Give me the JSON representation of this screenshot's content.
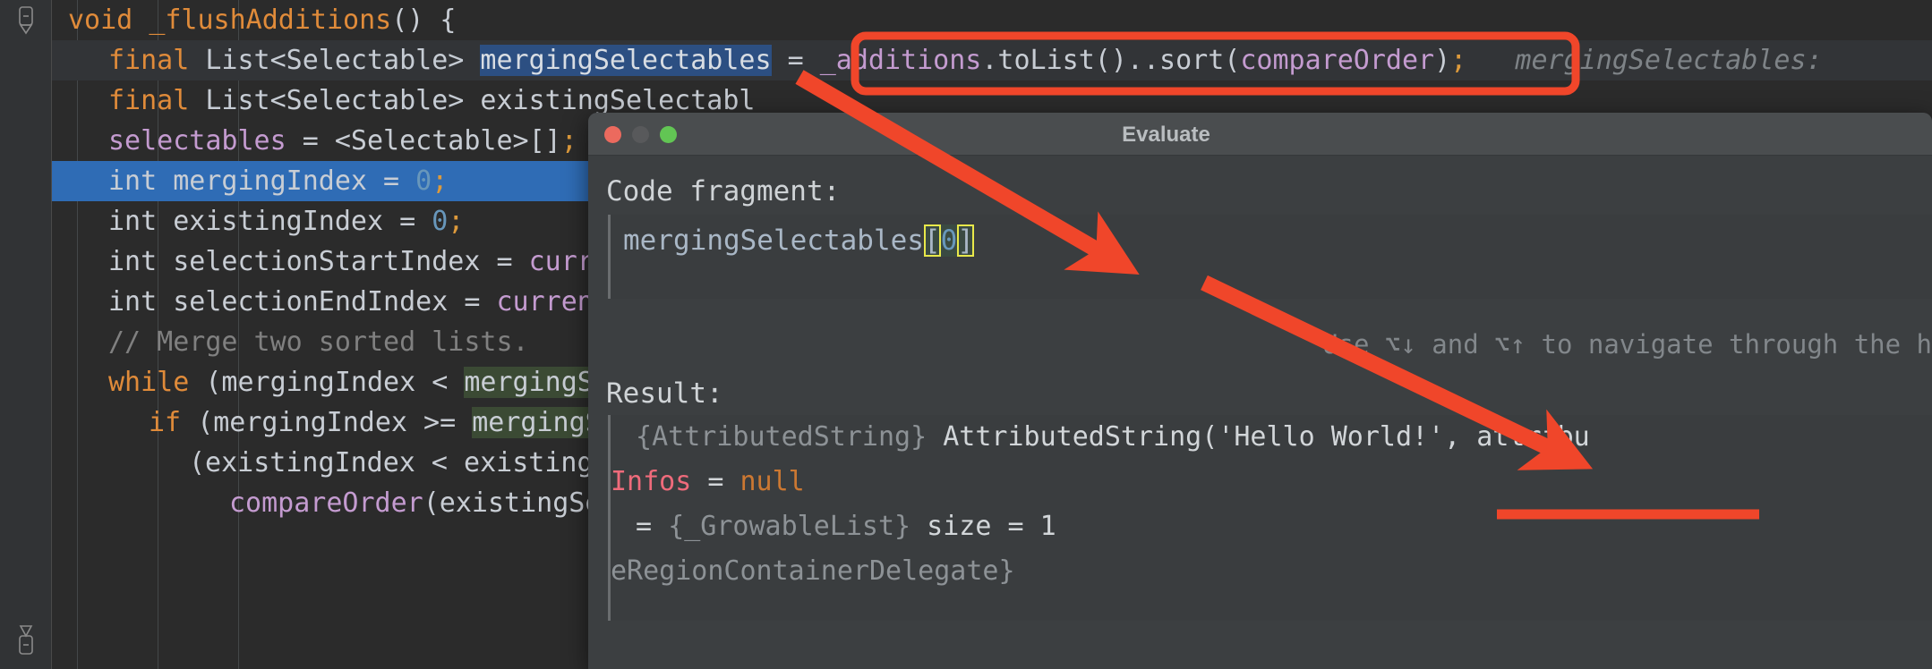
{
  "editor": {
    "lines": [
      {
        "indent": 0,
        "tokens": [
          {
            "t": "void ",
            "c": "kw-void"
          },
          {
            "t": "_flushAdditions",
            "c": "fn"
          },
          {
            "t": "() {",
            "c": "plain"
          }
        ],
        "state": "normal"
      },
      {
        "indent": 1,
        "tokens": [
          {
            "t": "final ",
            "c": "kw"
          },
          {
            "t": "List<Selectable> ",
            "c": "type"
          },
          {
            "t": "mergingSelectables",
            "c": "sel-blue"
          },
          {
            "t": " = ",
            "c": "plain"
          },
          {
            "t": "_additions",
            "c": "field"
          },
          {
            "t": ".toList()..",
            "c": "plain"
          },
          {
            "t": "sort",
            "c": "plain"
          },
          {
            "t": "(",
            "c": "plain"
          },
          {
            "t": "compareOrder",
            "c": "field"
          },
          {
            "t": ")",
            "c": "plain"
          },
          {
            "t": ";",
            "c": "punc"
          }
        ],
        "hint": "   mergingSelectables:",
        "state": "soft-hl"
      },
      {
        "indent": 1,
        "tokens": [
          {
            "t": "final ",
            "c": "kw"
          },
          {
            "t": "List<Selectable> ",
            "c": "type"
          },
          {
            "t": "existingSelectabl",
            "c": "plain"
          }
        ],
        "state": "normal"
      },
      {
        "indent": 1,
        "tokens": [
          {
            "t": "selectables",
            "c": "field"
          },
          {
            "t": " = <Selectable>[]",
            "c": "plain"
          },
          {
            "t": ";",
            "c": "punc"
          }
        ],
        "state": "normal"
      },
      {
        "indent": 1,
        "tokens": [
          {
            "t": "int mergingIndex = ",
            "c": "plain"
          },
          {
            "t": "0",
            "c": "num"
          },
          {
            "t": ";",
            "c": "punc"
          }
        ],
        "state": "caret-line"
      },
      {
        "indent": 1,
        "tokens": [
          {
            "t": "int existingIndex = ",
            "c": "plain"
          },
          {
            "t": "0",
            "c": "num"
          },
          {
            "t": ";",
            "c": "punc"
          }
        ],
        "state": "normal"
      },
      {
        "indent": 1,
        "tokens": [
          {
            "t": "int selectionStartIndex = ",
            "c": "plain"
          },
          {
            "t": "currentSelecti",
            "c": "field"
          }
        ],
        "state": "normal"
      },
      {
        "indent": 1,
        "tokens": [
          {
            "t": "int selectionEndIndex = ",
            "c": "plain"
          },
          {
            "t": "currentSelection",
            "c": "field"
          }
        ],
        "state": "normal"
      },
      {
        "indent": 1,
        "tokens": [
          {
            "t": "// Merge two sorted lists.",
            "c": "comment"
          }
        ],
        "state": "normal"
      },
      {
        "indent": 1,
        "tokens": [
          {
            "t": "while ",
            "c": "kw"
          },
          {
            "t": "(mergingIndex < ",
            "c": "plain"
          },
          {
            "t": "mergingSelectables",
            "c": "sel-green"
          }
        ],
        "state": "normal"
      },
      {
        "indent": 2,
        "tokens": [
          {
            "t": "if ",
            "c": "kw"
          },
          {
            "t": "(mergingIndex >= ",
            "c": "plain"
          },
          {
            "t": "mergingSelectables",
            "c": "sel-green"
          }
        ],
        "state": "normal"
      },
      {
        "indent": 3,
        "tokens": [
          {
            "t": "(existingIndex < existingSelectabl",
            "c": "plain"
          }
        ],
        "state": "normal"
      },
      {
        "indent": 4,
        "tokens": [
          {
            "t": "compareOrder",
            "c": "method"
          },
          {
            "t": "(existingSelectabl",
            "c": "plain"
          }
        ],
        "state": "normal"
      }
    ],
    "fold_markers": [
      "collapse-top",
      "collapse-bottom"
    ]
  },
  "dialog": {
    "title": "Evaluate",
    "window_controls": [
      "close",
      "minimize",
      "maximize"
    ],
    "code_fragment_label": "Code fragment:",
    "code_fragment_value": "mergingSelectables",
    "code_fragment_index_open": "[",
    "code_fragment_index_num": "0",
    "code_fragment_index_close": "]",
    "navigation_hint": "Use ⌥↓ and ⌥↑ to navigate through the h",
    "result_label": "Result:",
    "result_lines": [
      {
        "segments": [
          {
            "t": " {AttributedString} ",
            "c": "res-dim"
          },
          {
            "t": "AttributedString('Hello World!', attribu",
            "c": "res-plain"
          }
        ]
      },
      {
        "segments": [
          {
            "t": "Infos",
            "c": "res-pink"
          },
          {
            "t": " = ",
            "c": "res-plain"
          },
          {
            "t": "null",
            "c": "res-orange"
          }
        ],
        "noindent": true
      },
      {
        "segments": [
          {
            "t": " = ",
            "c": "res-plain"
          },
          {
            "t": "{_GrowableList}",
            "c": "res-dim"
          },
          {
            "t": " size = 1",
            "c": "res-plain"
          }
        ]
      },
      {
        "segments": [
          {
            "t": "eRegionContainerDelegate}",
            "c": "res-dim"
          }
        ],
        "noindent": true
      }
    ]
  },
  "annotations": {
    "accent_color": "#f0462a",
    "shapes": [
      {
        "name": "highlight-rectangle-expression",
        "type": "rect"
      },
      {
        "name": "arrow-expression-to-code-fragment",
        "type": "arrow"
      },
      {
        "name": "arrow-code-fragment-to-result",
        "type": "arrow"
      },
      {
        "name": "underline-hello-world",
        "type": "line"
      }
    ]
  },
  "colors": {
    "editor_bg": "#2b2b2b",
    "gutter_bg": "#313335",
    "dialog_bg": "#3c3f41",
    "caret_line": "#2f6cb5",
    "selection_blue": "#2c4f82",
    "selection_green": "#3b4a34",
    "annotation_red": "#f0462a"
  }
}
